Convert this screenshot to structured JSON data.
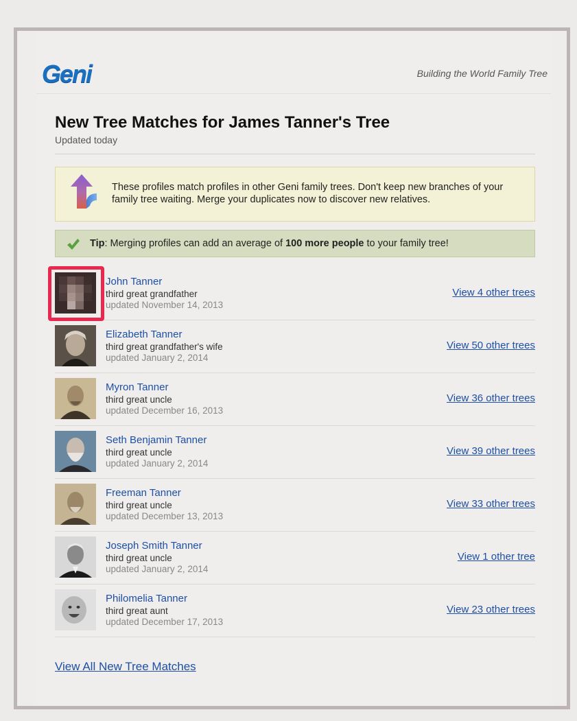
{
  "header": {
    "logo_text": "Geni",
    "tagline": "Building the World Family Tree"
  },
  "title": "New Tree Matches for James Tanner's Tree",
  "subtitle": "Updated today",
  "intro": {
    "icon": "merge-arrow-icon",
    "message": "These profiles match profiles in other Geni family trees. Don't keep new branches of your family tree waiting. Merge your duplicates now to discover new relatives."
  },
  "tip": {
    "icon": "checkmark-icon",
    "label": "Tip",
    "text_before": ": Merging profiles can add an average of ",
    "bold": "100 more people",
    "text_after": " to your family tree!"
  },
  "matches": [
    {
      "name": "John Tanner",
      "relation": "third great grandfather",
      "updated": "updated November 14, 2013",
      "link": "View 4 other trees",
      "highlighted": true
    },
    {
      "name": "Elizabeth Tanner",
      "relation": "third great grandfather's wife",
      "updated": "updated January 2, 2014",
      "link": "View 50 other trees"
    },
    {
      "name": "Myron Tanner",
      "relation": "third great uncle",
      "updated": "updated December 16, 2013",
      "link": "View 36 other trees"
    },
    {
      "name": "Seth Benjamin Tanner",
      "relation": "third great uncle",
      "updated": "updated January 2, 2014",
      "link": "View 39 other trees"
    },
    {
      "name": "Freeman Tanner",
      "relation": "third great uncle",
      "updated": "updated December 13, 2013",
      "link": "View 33 other trees"
    },
    {
      "name": "Joseph Smith Tanner",
      "relation": "third great uncle",
      "updated": "updated January 2, 2014",
      "link": "View 1 other tree"
    },
    {
      "name": "Philomelia Tanner",
      "relation": "third great aunt",
      "updated": "updated December 17, 2013",
      "link": "View 23 other trees"
    }
  ],
  "footer_link": "View All New Tree Matches",
  "colors": {
    "link": "#1d4fa5",
    "highlight": "#e8284e",
    "intro_bg": "#f3f2d6",
    "tip_bg": "#d6dcbf",
    "logo": "#1a6fc0"
  }
}
